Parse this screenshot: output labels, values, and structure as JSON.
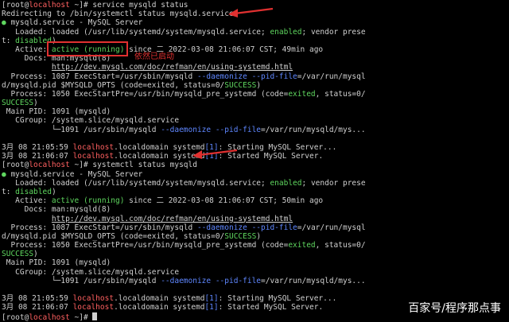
{
  "annotation": "依然已启动",
  "watermark": "百家号/程序那点事",
  "colors": {
    "background": "#000000",
    "text": "#d0d0d0",
    "green": "#5fd75f",
    "blue": "#5f87ff",
    "red": "#ff6060",
    "annotation": "#e03030"
  },
  "lines": [
    [
      {
        "t": "[root@"
      },
      {
        "t": "localhost",
        "c": "red"
      },
      {
        "t": " ~]# service mysqld status"
      }
    ],
    [
      {
        "t": "Redirecting to /bin/systemctl status mysqld.service"
      }
    ],
    [
      {
        "t": "● ",
        "c": "green"
      },
      {
        "t": "mysqld.service - MySQL Server"
      }
    ],
    [
      {
        "t": "   Loaded: loaded (/usr/lib/systemd/system/mysqld.service; "
      },
      {
        "t": "enabled",
        "c": "green"
      },
      {
        "t": "; vendor prese"
      }
    ],
    [
      {
        "t": "t: "
      },
      {
        "t": "disabled",
        "c": "green"
      },
      {
        "t": ")"
      }
    ],
    [
      {
        "t": "   Active: "
      },
      {
        "t": "active (running)",
        "c": "green"
      },
      {
        "t": " since 二 2022-03-08 21:06:07 CST; 49min ago"
      }
    ],
    [
      {
        "t": "     Docs: man:mysqld(8)"
      }
    ],
    [
      {
        "t": "           "
      },
      {
        "t": "http://dev.mysql.com/doc/refman/en/using-systemd.html",
        "c": "u"
      }
    ],
    [
      {
        "t": "  Process: 1087 ExecStart=/usr/sbin/mysqld "
      },
      {
        "t": "--daemonize --pid-file",
        "c": "bluef"
      },
      {
        "t": "=/var/run/mysql"
      }
    ],
    [
      {
        "t": "d/mysqld.pid $MYSQLD_OPTS (code=exited, status=0/"
      },
      {
        "t": "SUCCESS",
        "c": "green"
      },
      {
        "t": ")"
      }
    ],
    [
      {
        "t": "  Process: 1050 ExecStartPre=/usr/bin/mysqld_pre_systemd (code="
      },
      {
        "t": "exited",
        "c": "green"
      },
      {
        "t": ", status=0/"
      }
    ],
    [
      {
        "t": "SUCCESS",
        "c": "green"
      },
      {
        "t": ")"
      }
    ],
    [
      {
        "t": " Main PID: 1091 (mysqld)"
      }
    ],
    [
      {
        "t": "   CGroup: /system.slice/mysqld.service"
      }
    ],
    [
      {
        "t": "           └─1091 /usr/sbin/mysqld "
      },
      {
        "t": "--daemonize --pid-file",
        "c": "bluef"
      },
      {
        "t": "=/var/run/mysqld/mys..."
      }
    ],
    [
      {
        "t": ""
      }
    ],
    [
      {
        "t": "3月 08 21:05:59 "
      },
      {
        "t": "localhost",
        "c": "red"
      },
      {
        "t": ".localdomain systemd"
      },
      {
        "t": "[1]",
        "c": "bluef"
      },
      {
        "t": ": Starting MySQL Server..."
      }
    ],
    [
      {
        "t": "3月 08 21:06:07 "
      },
      {
        "t": "localhost",
        "c": "red"
      },
      {
        "t": ".localdomain systemd"
      },
      {
        "t": "[1]",
        "c": "bluef"
      },
      {
        "t": ": Started MySQL Server."
      }
    ],
    [
      {
        "t": "[root@"
      },
      {
        "t": "localhost",
        "c": "red"
      },
      {
        "t": " ~]# systemctl status mysqld"
      }
    ],
    [
      {
        "t": "● ",
        "c": "green"
      },
      {
        "t": "mysqld.service - MySQL Server"
      }
    ],
    [
      {
        "t": "   Loaded: loaded (/usr/lib/systemd/system/mysqld.service; "
      },
      {
        "t": "enabled",
        "c": "green"
      },
      {
        "t": "; vendor prese"
      }
    ],
    [
      {
        "t": "t: "
      },
      {
        "t": "disabled",
        "c": "green"
      },
      {
        "t": ")"
      }
    ],
    [
      {
        "t": "   Active: "
      },
      {
        "t": "active (running)",
        "c": "green"
      },
      {
        "t": " since 二 2022-03-08 21:06:07 CST; 50min ago"
      }
    ],
    [
      {
        "t": "     Docs: man:mysqld(8)"
      }
    ],
    [
      {
        "t": "           "
      },
      {
        "t": "http://dev.mysql.com/doc/refman/en/using-systemd.html",
        "c": "u"
      }
    ],
    [
      {
        "t": "  Process: 1087 ExecStart=/usr/sbin/mysqld "
      },
      {
        "t": "--daemonize --pid-file",
        "c": "bluef"
      },
      {
        "t": "=/var/run/mysql"
      }
    ],
    [
      {
        "t": "d/mysqld.pid $MYSQLD_OPTS (code=exited, status=0/"
      },
      {
        "t": "SUCCESS",
        "c": "green"
      },
      {
        "t": ")"
      }
    ],
    [
      {
        "t": "  Process: 1050 ExecStartPre=/usr/bin/mysqld_pre_systemd (code="
      },
      {
        "t": "exited",
        "c": "green"
      },
      {
        "t": ", status=0/"
      }
    ],
    [
      {
        "t": "SUCCESS",
        "c": "green"
      },
      {
        "t": ")"
      }
    ],
    [
      {
        "t": " Main PID: 1091 (mysqld)"
      }
    ],
    [
      {
        "t": "   CGroup: /system.slice/mysqld.service"
      }
    ],
    [
      {
        "t": "           └─1091 /usr/sbin/mysqld "
      },
      {
        "t": "--daemonize --pid-file",
        "c": "bluef"
      },
      {
        "t": "=/var/run/mysqld/mys..."
      }
    ],
    [
      {
        "t": ""
      }
    ],
    [
      {
        "t": "3月 08 21:05:59 "
      },
      {
        "t": "localhost",
        "c": "red"
      },
      {
        "t": ".localdomain systemd"
      },
      {
        "t": "[1]",
        "c": "bluef"
      },
      {
        "t": ": Starting MySQL Server..."
      }
    ],
    [
      {
        "t": "3月 08 21:06:07 "
      },
      {
        "t": "localhost",
        "c": "red"
      },
      {
        "t": ".localdomain systemd"
      },
      {
        "t": "[1]",
        "c": "bluef"
      },
      {
        "t": ": Started MySQL Server."
      }
    ],
    [
      {
        "t": "[root@"
      },
      {
        "t": "localhost",
        "c": "red"
      },
      {
        "t": " ~]# "
      },
      {
        "cursor": true
      }
    ]
  ]
}
